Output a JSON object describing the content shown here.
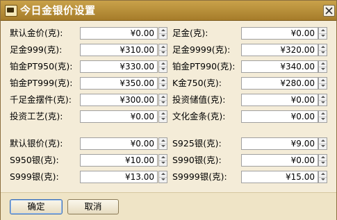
{
  "window": {
    "title": "今日金银价设置"
  },
  "gold_left": [
    {
      "label": "默认金价(克):",
      "value": "¥0.00"
    },
    {
      "label": "足金999(克):",
      "value": "¥310.00"
    },
    {
      "label": "铂金PT950(克):",
      "value": "¥330.00"
    },
    {
      "label": "铂金PT999(克):",
      "value": "¥350.00"
    },
    {
      "label": "千足金摆件(克):",
      "value": "¥300.00"
    },
    {
      "label": "投资工艺(克):",
      "value": "¥0.00"
    }
  ],
  "gold_right": [
    {
      "label": "足金(克):",
      "value": "¥0.00"
    },
    {
      "label": "足金9999(克):",
      "value": "¥320.00"
    },
    {
      "label": "铂金PT990(克):",
      "value": "¥340.00"
    },
    {
      "label": "K金750(克):",
      "value": "¥280.00"
    },
    {
      "label": "投资储值(克):",
      "value": "¥0.00"
    },
    {
      "label": "文化金条(克):",
      "value": "¥0.00"
    }
  ],
  "silver_left": [
    {
      "label": "默认银价(克):",
      "value": "¥0.00"
    },
    {
      "label": "S950银(克):",
      "value": "¥10.00"
    },
    {
      "label": "S999银(克):",
      "value": "¥13.00"
    }
  ],
  "silver_right": [
    {
      "label": "S925银(克):",
      "value": "¥9.00"
    },
    {
      "label": "S990银(克):",
      "value": "¥0.00"
    },
    {
      "label": "S9999银(克):",
      "value": "¥15.00"
    }
  ],
  "buttons": {
    "ok": "确定",
    "cancel": "取消"
  }
}
